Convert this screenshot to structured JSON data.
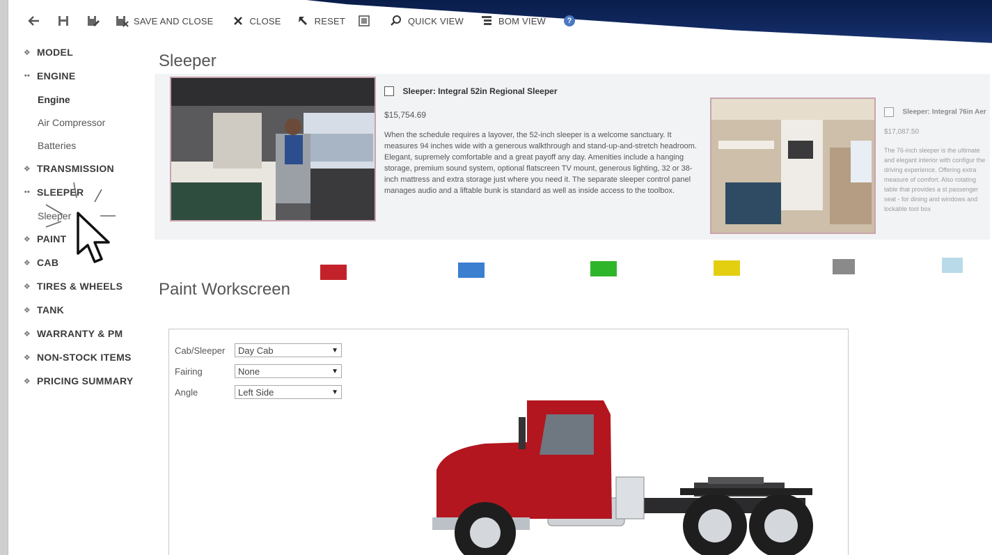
{
  "toolbar": {
    "save_and_close": "SAVE AND CLOSE",
    "close": "CLOSE",
    "reset": "RESET",
    "quick_view": "QUICK VIEW",
    "bom_view": "BOM VIEW"
  },
  "sidebar": {
    "items": [
      {
        "label": "MODEL",
        "marker": "diamond"
      },
      {
        "label": "ENGINE",
        "marker": "dots",
        "sub": [
          "Engine",
          "Air Compressor",
          "Batteries"
        ]
      },
      {
        "label": "TRANSMISSION",
        "marker": "diamond"
      },
      {
        "label": "SLEEPER",
        "marker": "dots",
        "sub": [
          "Sleeper"
        ]
      },
      {
        "label": "PAINT",
        "marker": "diamond"
      },
      {
        "label": "CAB",
        "marker": "diamond"
      },
      {
        "label": "TIRES & WHEELS",
        "marker": "diamond"
      },
      {
        "label": "TANK",
        "marker": "diamond"
      },
      {
        "label": "WARRANTY & PM",
        "marker": "diamond"
      },
      {
        "label": "NON-STOCK ITEMS",
        "marker": "diamond"
      },
      {
        "label": "PRICING SUMMARY",
        "marker": "diamond"
      }
    ]
  },
  "sleeper": {
    "title": "Sleeper",
    "option1": {
      "name": "Sleeper: Integral 52in Regional Sleeper",
      "price": "$15,754.69",
      "description": "When the schedule requires a layover, the 52-inch sleeper is a welcome sanctuary. It measures 94 inches wide with a generous walkthrough and stand-up-and-stretch headroom. Elegant, supremely comfortable and a great payoff any day. Amenities include a hanging storage, premium sound system, optional flatscreen TV mount, generous lighting, 32 or 38-inch mattress and extra storage just where you need it. The separate sleeper control panel manages audio and a liftable bunk is standard as well as inside access to the toolbox."
    },
    "option2": {
      "name": "Sleeper: Integral 76in Aer",
      "price": "$17,087.50",
      "description": "The 76-inch sleeper is the ultimate and elegant interior with configur the driving experience. Offering extra measure of comfort. Also rotating table that provides a st passenger seat - for dining and windows and lockable tool box"
    }
  },
  "paint": {
    "title": "Paint Workscreen",
    "swatches": [
      "#c4222b",
      "#3a7fd0",
      "#2fb52a",
      "#e3cf10",
      "#8a8a8a",
      "#b9dbe9"
    ],
    "fields": [
      {
        "label": "Cab/Sleeper",
        "value": "Day Cab"
      },
      {
        "label": "Fairing",
        "value": "None"
      },
      {
        "label": "Angle",
        "value": "Left Side"
      }
    ],
    "truck_color": "#b3161f"
  }
}
